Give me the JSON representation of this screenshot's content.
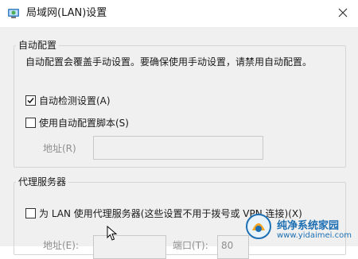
{
  "window": {
    "title": "局域网(LAN)设置",
    "close_glyph": "✕"
  },
  "auto_config": {
    "group_title": "自动配置",
    "description": "自动配置会覆盖手动设置。要确保使用手动设置，请禁用自动配置。",
    "auto_detect": {
      "label": "自动检测设置(A)",
      "checked": true
    },
    "use_script": {
      "label": "使用自动配置脚本(S)",
      "checked": false
    },
    "address_label": "地址(R)",
    "address_value": ""
  },
  "proxy": {
    "group_title": "代理服务器",
    "use_proxy": {
      "label": "为 LAN 使用代理服务器(这些设置不用于拨号或 VPN 连接)(X)",
      "checked": false
    },
    "address_label": "地址(E):",
    "port_label": "端口(T):",
    "port_value": "80"
  },
  "watermark": {
    "line1": "纯净系统家园",
    "line2": "www.yidaimei.com"
  },
  "colors": {
    "accent": "#1d6fb3",
    "disabled_text": "#8e8e8e",
    "client_bg": "#f0f0f0",
    "group_border": "#d5d5d5"
  }
}
